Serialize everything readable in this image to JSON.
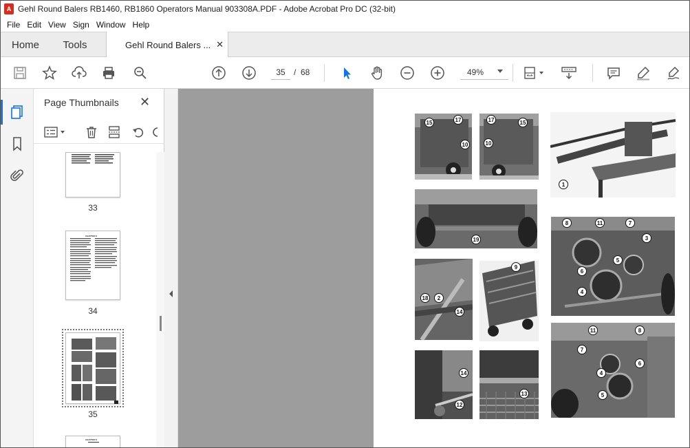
{
  "window": {
    "app_icon_letter": "A",
    "title": "Gehl Round Balers RB1460, RB1860 Operators Manual 903308A.PDF - Adobe Acrobat Pro DC (32-bit)"
  },
  "menu": [
    "File",
    "Edit",
    "View",
    "Sign",
    "Window",
    "Help"
  ],
  "tabs": {
    "home": "Home",
    "tools": "Tools",
    "document": "Gehl Round Balers ...",
    "close_glyph": "✕"
  },
  "toolbar": {
    "current_page": "35",
    "page_separator": "/",
    "total_pages": "68",
    "zoom": "49%",
    "accent_color": "#1473e6"
  },
  "thumbnail_panel": {
    "title": "Page Thumbnails",
    "close_glyph": "✕",
    "pages": [
      {
        "label": "33"
      },
      {
        "label": "34",
        "heading": "CHAPTER 6"
      },
      {
        "label": "35",
        "selected": true
      },
      {
        "heading": "CHAPTER 6"
      }
    ]
  },
  "figure": {
    "callouts": [
      "15",
      "17",
      "10",
      "17",
      "15",
      "10",
      "1",
      "19",
      "8",
      "11",
      "7",
      "3",
      "5",
      "6",
      "4",
      "18",
      "2",
      "14",
      "9",
      "11",
      "8",
      "7",
      "6",
      "4",
      "5",
      "14",
      "12",
      "13"
    ]
  }
}
